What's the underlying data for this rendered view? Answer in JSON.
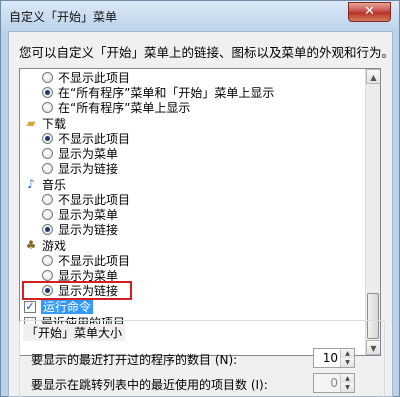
{
  "window": {
    "title": "自定义「开始」菜单",
    "close_glyph": "✕"
  },
  "description": "您可以自定义「开始」菜单上的链接、图标以及菜单的外观和行为。",
  "list": {
    "top_group": {
      "options": [
        {
          "label": "不显示此项目",
          "selected": false
        },
        {
          "label": "在“所有程序”菜单和「开始」菜单上显示",
          "selected": true
        },
        {
          "label": "在“所有程序”菜单上显示",
          "selected": false
        }
      ]
    },
    "downloads": {
      "label": "下载",
      "icon": "folder-icon",
      "options": [
        {
          "label": "不显示此项目",
          "selected": true
        },
        {
          "label": "显示为菜单",
          "selected": false
        },
        {
          "label": "显示为链接",
          "selected": false
        }
      ]
    },
    "music": {
      "label": "音乐",
      "icon": "music-note-icon",
      "options": [
        {
          "label": "不显示此项目",
          "selected": false
        },
        {
          "label": "显示为菜单",
          "selected": false
        },
        {
          "label": "显示为链接",
          "selected": true
        }
      ]
    },
    "games": {
      "label": "游戏",
      "icon": "games-icon",
      "options": [
        {
          "label": "不显示此项目",
          "selected": false
        },
        {
          "label": "显示为菜单",
          "selected": false
        },
        {
          "label": "显示为链接",
          "selected": true
        }
      ]
    },
    "run_command": {
      "label": "运行命令",
      "checked": true,
      "highlighted": true
    },
    "recent_items": {
      "label": "最近使用的项目",
      "checked": false
    }
  },
  "size_section": {
    "title": "「开始」菜单大小",
    "recent_programs": {
      "label": "要显示的最近打开过的程序的数目 (N):",
      "value": "10"
    },
    "jump_list": {
      "label": "要显示在跳转列表中的最近使用的项目数 (I):",
      "value": "0"
    }
  },
  "colors": {
    "highlight_box": "#d42020",
    "selection": "#3399ff"
  }
}
